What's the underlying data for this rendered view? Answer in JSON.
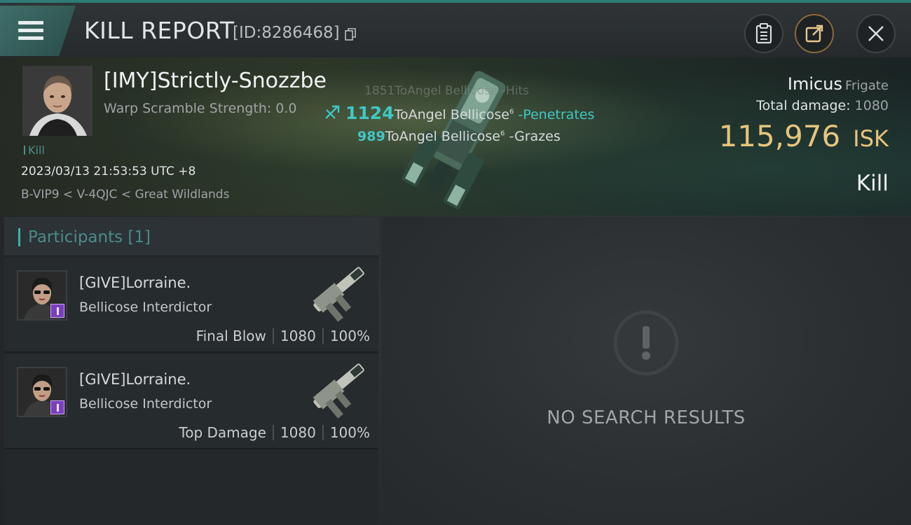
{
  "header": {
    "title": "KILL REPORT",
    "report_id": "[ID:8286468]"
  },
  "victim": {
    "name": "[IMY]Strictly-Snozzbe",
    "warp_scramble": "Warp Scramble Strength: 0.0",
    "tag": "Kill",
    "datetime": "2023/03/13 21:53:53 UTC +8",
    "location": "B-VIP9 < V-4QJC < Great Wildlands",
    "ship_name": "Imicus",
    "ship_class": "Frigate",
    "total_damage_label": "Total damage:",
    "total_damage": "1080",
    "isk_value": "115,976",
    "isk_unit": "ISK",
    "result": "Kill"
  },
  "hits": [
    {
      "damage": "1851",
      "target": "ToAngel Bellicose",
      "effect": "-Hits"
    },
    {
      "damage": "1124",
      "target": "ToAngel Bellicose",
      "level": "6",
      "effect": "-Penetrates"
    },
    {
      "damage": "989",
      "target": "ToAngel Bellicose",
      "level": "6",
      "effect": "-Grazes"
    }
  ],
  "participants": {
    "title": "Participants [1]",
    "items": [
      {
        "name": "[GIVE]Lorraine.",
        "ship": "Bellicose Interdictor",
        "role": "Final Blow",
        "damage": "1080",
        "percent": "100%"
      },
      {
        "name": "[GIVE]Lorraine.",
        "ship": "Bellicose Interdictor",
        "role": "Top Damage",
        "damage": "1080",
        "percent": "100%"
      }
    ]
  },
  "results": {
    "empty_text": "NO SEARCH RESULTS"
  },
  "colors": {
    "accent_teal": "#3fc8c4",
    "isk_gold": "#e6c47d",
    "corp_purple": "#7a3fbf"
  },
  "icons": {
    "menu": "hamburger-icon",
    "copy": "copy-icon",
    "clipboard": "clipboard-icon",
    "share": "share-icon",
    "close": "close-icon",
    "weapon": "weapon-icon",
    "empty": "exclamation-icon"
  }
}
